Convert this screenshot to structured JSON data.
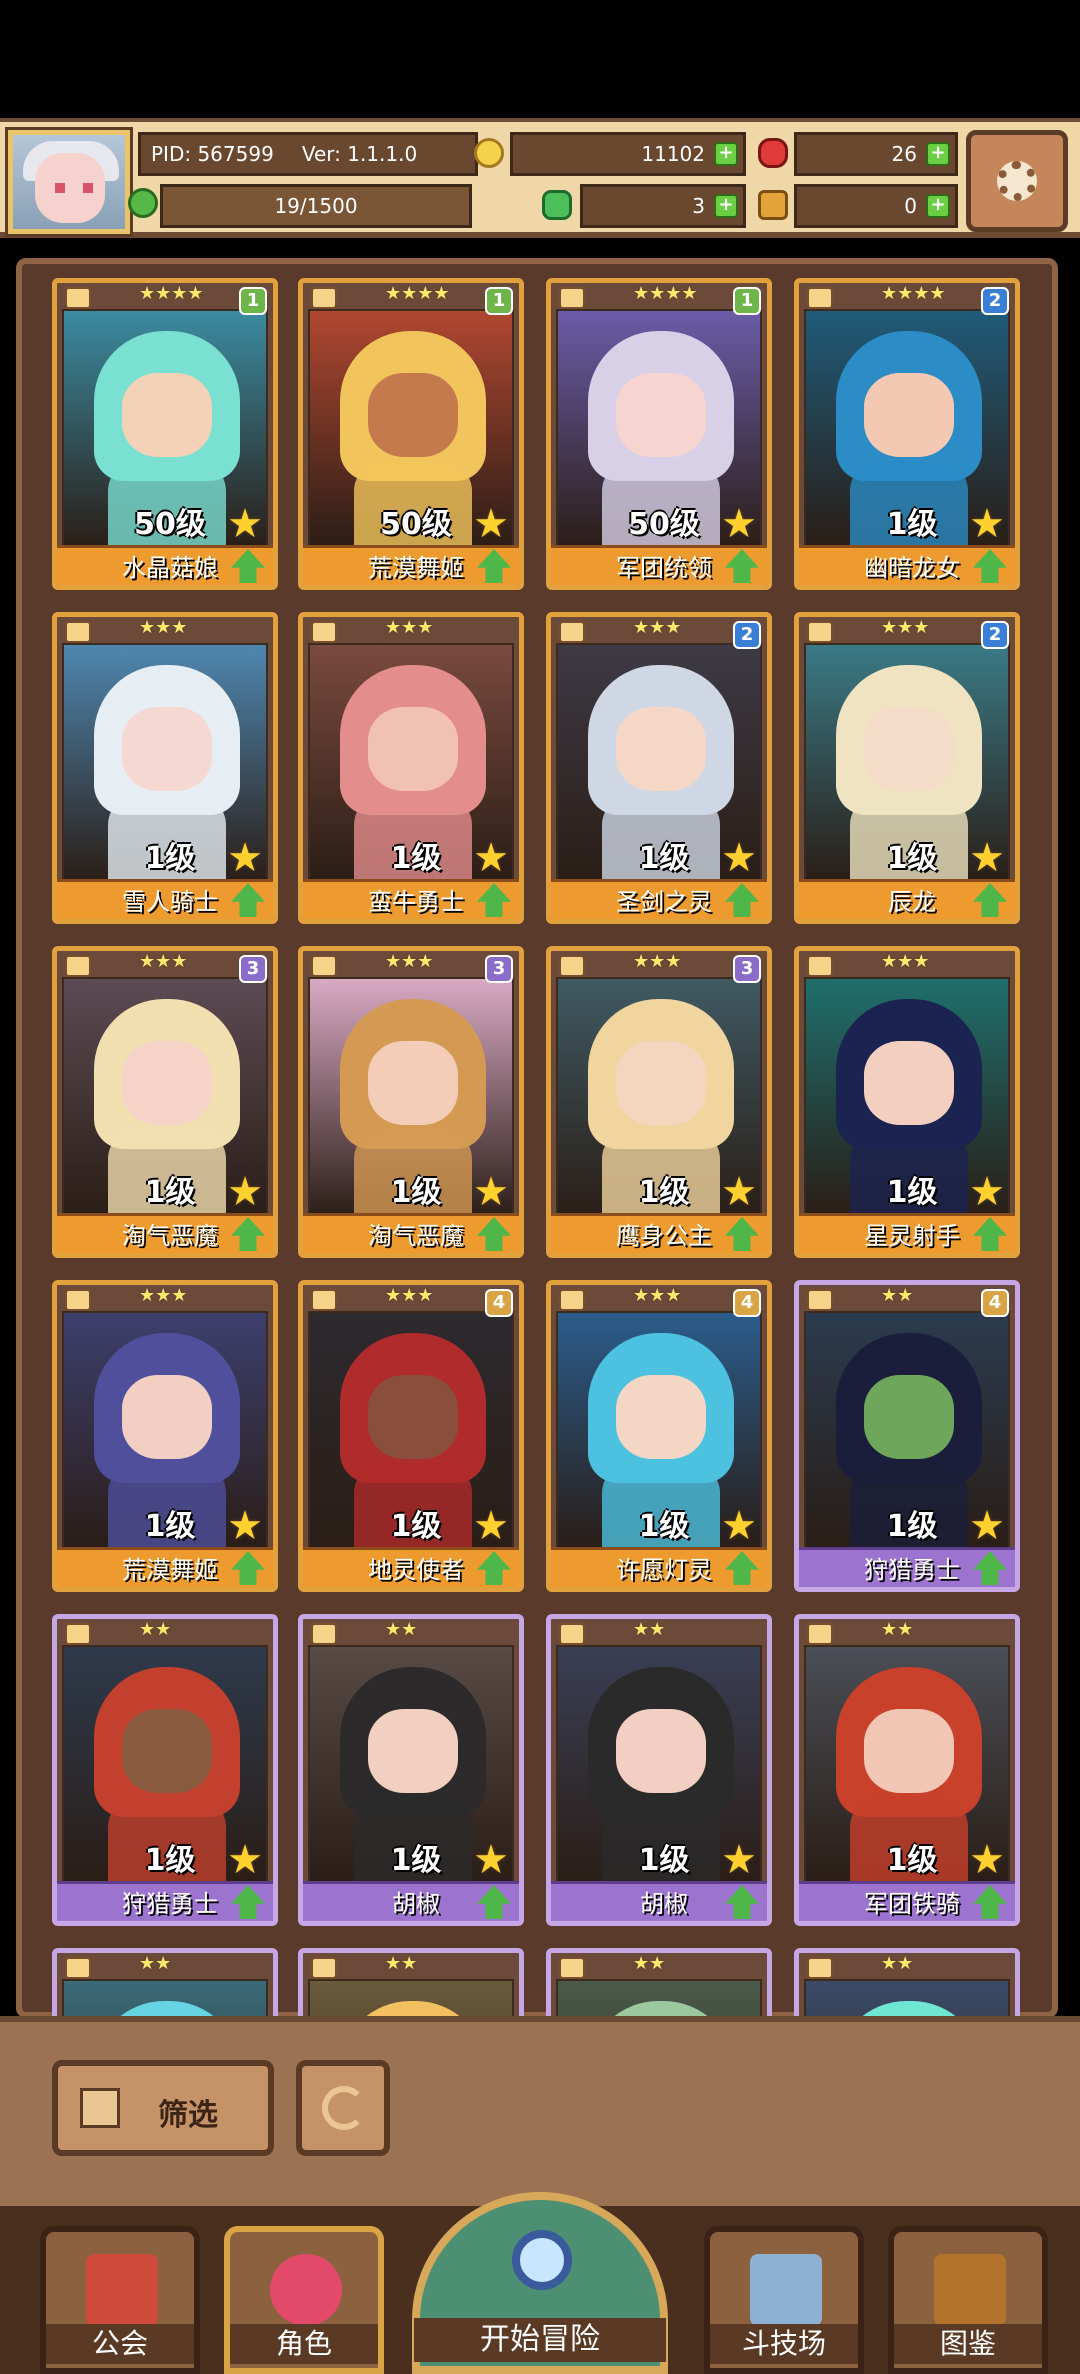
{
  "header": {
    "pid": "PID: 567599",
    "version": "Ver: 1.1.1.0",
    "gold": "11102",
    "gems": "26",
    "energy": "19/1500",
    "clover": "3",
    "keys": "0",
    "icons": [
      "avatar-portrait",
      "gold-coin-icon",
      "red-gem-icon",
      "energy-icon",
      "clover-icon",
      "key-icon",
      "plus-icon",
      "gear-icon"
    ]
  },
  "cards": [
    {
      "level": "50级",
      "name": "水晶菇娘",
      "stars": "★★★★",
      "badge": "1",
      "badge_color": "#6fb64a",
      "frame": "gold",
      "bg": "#3b8ba1",
      "skin": "#f4d2b8",
      "hair": "#79e0d2"
    },
    {
      "level": "50级",
      "name": "荒漠舞姬",
      "stars": "★★★★",
      "badge": "1",
      "badge_color": "#6fb64a",
      "frame": "gold",
      "bg": "#b04731",
      "skin": "#c47a4d",
      "hair": "#f2c55c"
    },
    {
      "level": "50级",
      "name": "军团统领",
      "stars": "★★★★",
      "badge": "1",
      "badge_color": "#6fb64a",
      "frame": "gold",
      "bg": "#6a5ca8",
      "skin": "#f6d4cf",
      "hair": "#d7d0e6"
    },
    {
      "level": "1级",
      "name": "幽暗龙女",
      "stars": "★★★★",
      "badge": "2",
      "badge_color": "#3a7fd6",
      "frame": "gold",
      "bg": "#1f5b79",
      "skin": "#f4c9b3",
      "hair": "#2b8cc6"
    },
    {
      "level": "1级",
      "name": "雪人骑士",
      "stars": "★★★",
      "badge": "",
      "badge_color": "",
      "frame": "gold",
      "bg": "#4f87b0",
      "skin": "#f6d8d2",
      "hair": "#e6edf3"
    },
    {
      "level": "1级",
      "name": "蛮牛勇士",
      "stars": "★★★",
      "badge": "",
      "badge_color": "",
      "frame": "gold",
      "bg": "#7a4a3e",
      "skin": "#f1c2b3",
      "hair": "#e48d8d"
    },
    {
      "level": "1级",
      "name": "圣剑之灵",
      "stars": "★★★",
      "badge": "2",
      "badge_color": "#3a7fd6",
      "frame": "gold",
      "bg": "#3d3a45",
      "skin": "#f4d7c6",
      "hair": "#cfd7e4"
    },
    {
      "level": "1级",
      "name": "辰龙",
      "stars": "★★★",
      "badge": "2",
      "badge_color": "#3a7fd6",
      "frame": "gold",
      "bg": "#3a7a86",
      "skin": "#f4dcc8",
      "hair": "#efe3c1"
    },
    {
      "level": "1级",
      "name": "淘气恶魔",
      "stars": "★★★",
      "badge": "3",
      "badge_color": "#8c6cc9",
      "frame": "gold",
      "bg": "#5c4b54",
      "skin": "#f5d3c6",
      "hair": "#f2dfb0"
    },
    {
      "level": "1级",
      "name": "淘气恶魔",
      "stars": "★★★",
      "badge": "3",
      "badge_color": "#8c6cc9",
      "frame": "gold",
      "bg": "#d8a9c3",
      "skin": "#f3cdb7",
      "hair": "#d49a54"
    },
    {
      "level": "1级",
      "name": "鹰身公主",
      "stars": "★★★",
      "badge": "3",
      "badge_color": "#8c6cc9",
      "frame": "gold",
      "bg": "#3f5a63",
      "skin": "#f4d6c0",
      "hair": "#f0d59e"
    },
    {
      "level": "1级",
      "name": "星灵射手",
      "stars": "★★★",
      "badge": "",
      "badge_color": "",
      "frame": "gold",
      "bg": "#1f6f6d",
      "skin": "#f3cfc0",
      "hair": "#1b2350"
    },
    {
      "level": "1级",
      "name": "荒漠舞姬",
      "stars": "★★★",
      "badge": "",
      "badge_color": "",
      "frame": "gold",
      "bg": "#3d3f6e",
      "skin": "#f2cfc2",
      "hair": "#4f4f9c"
    },
    {
      "level": "1级",
      "name": "地灵使者",
      "stars": "★★★",
      "badge": "4",
      "badge_color": "#d9a544",
      "frame": "gold",
      "bg": "#2d2a2f",
      "skin": "#8a4e3c",
      "hair": "#b02b2b"
    },
    {
      "level": "1级",
      "name": "许愿灯灵",
      "stars": "★★★",
      "badge": "4",
      "badge_color": "#d9a544",
      "frame": "gold",
      "bg": "#2b5c8c",
      "skin": "#f3d7c4",
      "hair": "#4cc1e0"
    },
    {
      "level": "1级",
      "name": "狩猎勇士",
      "stars": "★★",
      "badge": "4",
      "badge_color": "#d9a544",
      "frame": "purple",
      "bg": "#2b3b4f",
      "skin": "#6ea65c",
      "hair": "#1a1e3a"
    },
    {
      "level": "1级",
      "name": "狩猎勇士",
      "stars": "★★",
      "badge": "",
      "badge_color": "",
      "frame": "purple",
      "bg": "#2e3a4c",
      "skin": "#8a5a3e",
      "hair": "#c2402d"
    },
    {
      "level": "1级",
      "name": "胡椒",
      "stars": "★★",
      "badge": "",
      "badge_color": "",
      "frame": "purple",
      "bg": "#584a45",
      "skin": "#f1cfc1",
      "hair": "#2c2a2a"
    },
    {
      "level": "1级",
      "name": "胡椒",
      "stars": "★★",
      "badge": "",
      "badge_color": "",
      "frame": "purple",
      "bg": "#3a3f55",
      "skin": "#f2cfc2",
      "hair": "#2a2a2a"
    },
    {
      "level": "1级",
      "name": "军团铁骑",
      "stars": "★★",
      "badge": "",
      "badge_color": "",
      "frame": "purple",
      "bg": "#4a4e56",
      "skin": "#f1c6b5",
      "hair": "#c9402b"
    },
    {
      "level": "",
      "name": "",
      "stars": "★★",
      "badge": "",
      "badge_color": "",
      "frame": "purple",
      "bg": "#3a6a78",
      "skin": "#f1d0c0",
      "hair": "#67d4e3"
    },
    {
      "level": "",
      "name": "",
      "stars": "★★",
      "badge": "",
      "badge_color": "",
      "frame": "purple",
      "bg": "#6a5a3c",
      "skin": "#f1d0c0",
      "hair": "#f2c061"
    },
    {
      "level": "",
      "name": "",
      "stars": "★★",
      "badge": "",
      "badge_color": "",
      "frame": "purple",
      "bg": "#4a5a4a",
      "skin": "#f1d0c0",
      "hair": "#9cc8a0"
    },
    {
      "level": "",
      "name": "",
      "stars": "★★",
      "badge": "",
      "badge_color": "",
      "frame": "purple",
      "bg": "#3a4a66",
      "skin": "#f1d0c0",
      "hair": "#6ee6d2"
    }
  ],
  "controls": {
    "filter_label": "筛选"
  },
  "nav": {
    "guild": "公会",
    "characters": "角色",
    "adventure": "开始冒险",
    "arena": "斗技场",
    "codex": "图鉴"
  }
}
